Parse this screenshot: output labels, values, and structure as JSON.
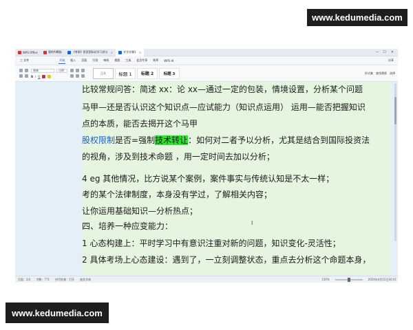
{
  "watermarks": {
    "top": "www.kedumedia.com",
    "bottom": "www.kedumedia.com"
  },
  "tabs": [
    {
      "label": "WPS Office",
      "color": "#d9312b"
    },
    {
      "label": "我的AI模板",
      "color": "#d9312b"
    },
    {
      "label": "《考研》投资国际化学习讲义",
      "color": "#1a5fd6"
    },
    {
      "label": "文字文稿1",
      "color": "#1a5fd6"
    }
  ],
  "menu": {
    "file": "三 文件",
    "items": [
      "开始",
      "插入",
      "页面",
      "引用",
      "审阅",
      "视图",
      "工具",
      "会员专享",
      "效率",
      "WPS AI"
    ],
    "active": "开始",
    "right": "分享"
  },
  "ribbon": {
    "font_name": "宋体",
    "font_size": "小四",
    "styles": [
      "正文",
      "标题 1",
      "标题 2",
      "标题 3"
    ],
    "right": [
      "样式集",
      "查找替换",
      "选择"
    ]
  },
  "document": {
    "lines": [
      {
        "text": "比较常规问答：简述 xx：论 xx—通过一定的包装，情境设置，分析某个问题"
      },
      {
        "text": "马甲—还是否认识这个知识点—应试能力（知识点运用） 运用—能否把握知识"
      },
      {
        "text": "点的本质，能否去揭开这个马甲"
      },
      {
        "kw": "股权限制",
        "pre": "是否=强制",
        "hl": "技术转让",
        "post": "：如何对二者予以分析，尤其是结合到国际投资法"
      },
      {
        "text": "的视角，涉及到技术命题 ，用一定时间去加以分析；"
      },
      {
        "text": "4 eg 其他情况，比方说某个案例，案件事实与传统认知是不太一样；"
      },
      {
        "text": "考的某个法律制度，本身没有学过，了解相关内容；"
      },
      {
        "text": "让你运用基础知识—分析热点；"
      },
      {
        "text": "四、培养一种应变能力："
      },
      {
        "text": "1 心态构建上：平时学习中有意识注重对新的问题，知识变化-灵活性；"
      },
      {
        "text": "2 具体考场上心态建设：遇到了，一立刻调整状态，重点去分析这个命题本身，"
      }
    ],
    "cursor_glyph": "I"
  },
  "status": {
    "page": "页面：2/3",
    "words": "字数：771",
    "spell": "拼写检查：打开",
    "font_missing": "缺失字体",
    "zoom": "150%",
    "timestamp": "2024年4月15日16:41"
  },
  "colors": {
    "keyword": "#1f5fc4",
    "highlight": "#2ee52e",
    "doc_bg": "#e5f5e0",
    "app_bg": "#e5eff8"
  }
}
